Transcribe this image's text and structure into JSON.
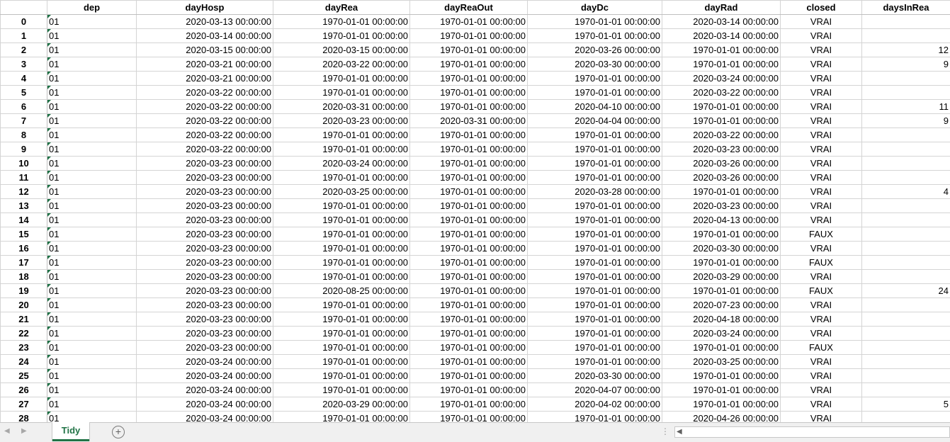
{
  "columns": [
    "dep",
    "dayHosp",
    "dayRea",
    "dayReaOut",
    "dayDc",
    "dayRad",
    "closed",
    "daysInRea"
  ],
  "rows": [
    {
      "idx": "0",
      "dep": "01",
      "dayHosp": "2020-03-13 00:00:00",
      "dayRea": "1970-01-01 00:00:00",
      "dayReaOut": "1970-01-01 00:00:00",
      "dayDc": "1970-01-01 00:00:00",
      "dayRad": "2020-03-14 00:00:00",
      "closed": "VRAI",
      "daysInRea": ""
    },
    {
      "idx": "1",
      "dep": "01",
      "dayHosp": "2020-03-14 00:00:00",
      "dayRea": "1970-01-01 00:00:00",
      "dayReaOut": "1970-01-01 00:00:00",
      "dayDc": "1970-01-01 00:00:00",
      "dayRad": "2020-03-14 00:00:00",
      "closed": "VRAI",
      "daysInRea": ""
    },
    {
      "idx": "2",
      "dep": "01",
      "dayHosp": "2020-03-15 00:00:00",
      "dayRea": "2020-03-15 00:00:00",
      "dayReaOut": "1970-01-01 00:00:00",
      "dayDc": "2020-03-26 00:00:00",
      "dayRad": "1970-01-01 00:00:00",
      "closed": "VRAI",
      "daysInRea": "12"
    },
    {
      "idx": "3",
      "dep": "01",
      "dayHosp": "2020-03-21 00:00:00",
      "dayRea": "2020-03-22 00:00:00",
      "dayReaOut": "1970-01-01 00:00:00",
      "dayDc": "2020-03-30 00:00:00",
      "dayRad": "1970-01-01 00:00:00",
      "closed": "VRAI",
      "daysInRea": "9"
    },
    {
      "idx": "4",
      "dep": "01",
      "dayHosp": "2020-03-21 00:00:00",
      "dayRea": "1970-01-01 00:00:00",
      "dayReaOut": "1970-01-01 00:00:00",
      "dayDc": "1970-01-01 00:00:00",
      "dayRad": "2020-03-24 00:00:00",
      "closed": "VRAI",
      "daysInRea": ""
    },
    {
      "idx": "5",
      "dep": "01",
      "dayHosp": "2020-03-22 00:00:00",
      "dayRea": "1970-01-01 00:00:00",
      "dayReaOut": "1970-01-01 00:00:00",
      "dayDc": "1970-01-01 00:00:00",
      "dayRad": "2020-03-22 00:00:00",
      "closed": "VRAI",
      "daysInRea": ""
    },
    {
      "idx": "6",
      "dep": "01",
      "dayHosp": "2020-03-22 00:00:00",
      "dayRea": "2020-03-31 00:00:00",
      "dayReaOut": "1970-01-01 00:00:00",
      "dayDc": "2020-04-10 00:00:00",
      "dayRad": "1970-01-01 00:00:00",
      "closed": "VRAI",
      "daysInRea": "11"
    },
    {
      "idx": "7",
      "dep": "01",
      "dayHosp": "2020-03-22 00:00:00",
      "dayRea": "2020-03-23 00:00:00",
      "dayReaOut": "2020-03-31 00:00:00",
      "dayDc": "2020-04-04 00:00:00",
      "dayRad": "1970-01-01 00:00:00",
      "closed": "VRAI",
      "daysInRea": "9"
    },
    {
      "idx": "8",
      "dep": "01",
      "dayHosp": "2020-03-22 00:00:00",
      "dayRea": "1970-01-01 00:00:00",
      "dayReaOut": "1970-01-01 00:00:00",
      "dayDc": "1970-01-01 00:00:00",
      "dayRad": "2020-03-22 00:00:00",
      "closed": "VRAI",
      "daysInRea": ""
    },
    {
      "idx": "9",
      "dep": "01",
      "dayHosp": "2020-03-22 00:00:00",
      "dayRea": "1970-01-01 00:00:00",
      "dayReaOut": "1970-01-01 00:00:00",
      "dayDc": "1970-01-01 00:00:00",
      "dayRad": "2020-03-23 00:00:00",
      "closed": "VRAI",
      "daysInRea": ""
    },
    {
      "idx": "10",
      "dep": "01",
      "dayHosp": "2020-03-23 00:00:00",
      "dayRea": "2020-03-24 00:00:00",
      "dayReaOut": "1970-01-01 00:00:00",
      "dayDc": "1970-01-01 00:00:00",
      "dayRad": "2020-03-26 00:00:00",
      "closed": "VRAI",
      "daysInRea": ""
    },
    {
      "idx": "11",
      "dep": "01",
      "dayHosp": "2020-03-23 00:00:00",
      "dayRea": "1970-01-01 00:00:00",
      "dayReaOut": "1970-01-01 00:00:00",
      "dayDc": "1970-01-01 00:00:00",
      "dayRad": "2020-03-26 00:00:00",
      "closed": "VRAI",
      "daysInRea": ""
    },
    {
      "idx": "12",
      "dep": "01",
      "dayHosp": "2020-03-23 00:00:00",
      "dayRea": "2020-03-25 00:00:00",
      "dayReaOut": "1970-01-01 00:00:00",
      "dayDc": "2020-03-28 00:00:00",
      "dayRad": "1970-01-01 00:00:00",
      "closed": "VRAI",
      "daysInRea": "4"
    },
    {
      "idx": "13",
      "dep": "01",
      "dayHosp": "2020-03-23 00:00:00",
      "dayRea": "1970-01-01 00:00:00",
      "dayReaOut": "1970-01-01 00:00:00",
      "dayDc": "1970-01-01 00:00:00",
      "dayRad": "2020-03-23 00:00:00",
      "closed": "VRAI",
      "daysInRea": ""
    },
    {
      "idx": "14",
      "dep": "01",
      "dayHosp": "2020-03-23 00:00:00",
      "dayRea": "1970-01-01 00:00:00",
      "dayReaOut": "1970-01-01 00:00:00",
      "dayDc": "1970-01-01 00:00:00",
      "dayRad": "2020-04-13 00:00:00",
      "closed": "VRAI",
      "daysInRea": ""
    },
    {
      "idx": "15",
      "dep": "01",
      "dayHosp": "2020-03-23 00:00:00",
      "dayRea": "1970-01-01 00:00:00",
      "dayReaOut": "1970-01-01 00:00:00",
      "dayDc": "1970-01-01 00:00:00",
      "dayRad": "1970-01-01 00:00:00",
      "closed": "FAUX",
      "daysInRea": ""
    },
    {
      "idx": "16",
      "dep": "01",
      "dayHosp": "2020-03-23 00:00:00",
      "dayRea": "1970-01-01 00:00:00",
      "dayReaOut": "1970-01-01 00:00:00",
      "dayDc": "1970-01-01 00:00:00",
      "dayRad": "2020-03-30 00:00:00",
      "closed": "VRAI",
      "daysInRea": ""
    },
    {
      "idx": "17",
      "dep": "01",
      "dayHosp": "2020-03-23 00:00:00",
      "dayRea": "1970-01-01 00:00:00",
      "dayReaOut": "1970-01-01 00:00:00",
      "dayDc": "1970-01-01 00:00:00",
      "dayRad": "1970-01-01 00:00:00",
      "closed": "FAUX",
      "daysInRea": ""
    },
    {
      "idx": "18",
      "dep": "01",
      "dayHosp": "2020-03-23 00:00:00",
      "dayRea": "1970-01-01 00:00:00",
      "dayReaOut": "1970-01-01 00:00:00",
      "dayDc": "1970-01-01 00:00:00",
      "dayRad": "2020-03-29 00:00:00",
      "closed": "VRAI",
      "daysInRea": ""
    },
    {
      "idx": "19",
      "dep": "01",
      "dayHosp": "2020-03-23 00:00:00",
      "dayRea": "2020-08-25 00:00:00",
      "dayReaOut": "1970-01-01 00:00:00",
      "dayDc": "1970-01-01 00:00:00",
      "dayRad": "1970-01-01 00:00:00",
      "closed": "FAUX",
      "daysInRea": "24"
    },
    {
      "idx": "20",
      "dep": "01",
      "dayHosp": "2020-03-23 00:00:00",
      "dayRea": "1970-01-01 00:00:00",
      "dayReaOut": "1970-01-01 00:00:00",
      "dayDc": "1970-01-01 00:00:00",
      "dayRad": "2020-07-23 00:00:00",
      "closed": "VRAI",
      "daysInRea": ""
    },
    {
      "idx": "21",
      "dep": "01",
      "dayHosp": "2020-03-23 00:00:00",
      "dayRea": "1970-01-01 00:00:00",
      "dayReaOut": "1970-01-01 00:00:00",
      "dayDc": "1970-01-01 00:00:00",
      "dayRad": "2020-04-18 00:00:00",
      "closed": "VRAI",
      "daysInRea": ""
    },
    {
      "idx": "22",
      "dep": "01",
      "dayHosp": "2020-03-23 00:00:00",
      "dayRea": "1970-01-01 00:00:00",
      "dayReaOut": "1970-01-01 00:00:00",
      "dayDc": "1970-01-01 00:00:00",
      "dayRad": "2020-03-24 00:00:00",
      "closed": "VRAI",
      "daysInRea": ""
    },
    {
      "idx": "23",
      "dep": "01",
      "dayHosp": "2020-03-23 00:00:00",
      "dayRea": "1970-01-01 00:00:00",
      "dayReaOut": "1970-01-01 00:00:00",
      "dayDc": "1970-01-01 00:00:00",
      "dayRad": "1970-01-01 00:00:00",
      "closed": "FAUX",
      "daysInRea": ""
    },
    {
      "idx": "24",
      "dep": "01",
      "dayHosp": "2020-03-24 00:00:00",
      "dayRea": "1970-01-01 00:00:00",
      "dayReaOut": "1970-01-01 00:00:00",
      "dayDc": "1970-01-01 00:00:00",
      "dayRad": "2020-03-25 00:00:00",
      "closed": "VRAI",
      "daysInRea": ""
    },
    {
      "idx": "25",
      "dep": "01",
      "dayHosp": "2020-03-24 00:00:00",
      "dayRea": "1970-01-01 00:00:00",
      "dayReaOut": "1970-01-01 00:00:00",
      "dayDc": "2020-03-30 00:00:00",
      "dayRad": "1970-01-01 00:00:00",
      "closed": "VRAI",
      "daysInRea": ""
    },
    {
      "idx": "26",
      "dep": "01",
      "dayHosp": "2020-03-24 00:00:00",
      "dayRea": "1970-01-01 00:00:00",
      "dayReaOut": "1970-01-01 00:00:00",
      "dayDc": "2020-04-07 00:00:00",
      "dayRad": "1970-01-01 00:00:00",
      "closed": "VRAI",
      "daysInRea": ""
    },
    {
      "idx": "27",
      "dep": "01",
      "dayHosp": "2020-03-24 00:00:00",
      "dayRea": "2020-03-29 00:00:00",
      "dayReaOut": "1970-01-01 00:00:00",
      "dayDc": "2020-04-02 00:00:00",
      "dayRad": "1970-01-01 00:00:00",
      "closed": "VRAI",
      "daysInRea": "5"
    },
    {
      "idx": "28",
      "dep": "01",
      "dayHosp": "2020-03-24 00:00:00",
      "dayRea": "1970-01-01 00:00:00",
      "dayReaOut": "1970-01-01 00:00:00",
      "dayDc": "1970-01-01 00:00:00",
      "dayRad": "2020-04-26 00:00:00",
      "closed": "VRAI",
      "daysInRea": ""
    }
  ],
  "tabs": {
    "active_sheet": "Tidy",
    "add_sheet_icon": "plus-circle-icon",
    "prev_icon": "chevron-left-icon",
    "next_icon": "chevron-right-icon"
  },
  "colors": {
    "accent": "#217346",
    "error_marker": "#1e7145",
    "gridline": "#d4d4d4"
  }
}
